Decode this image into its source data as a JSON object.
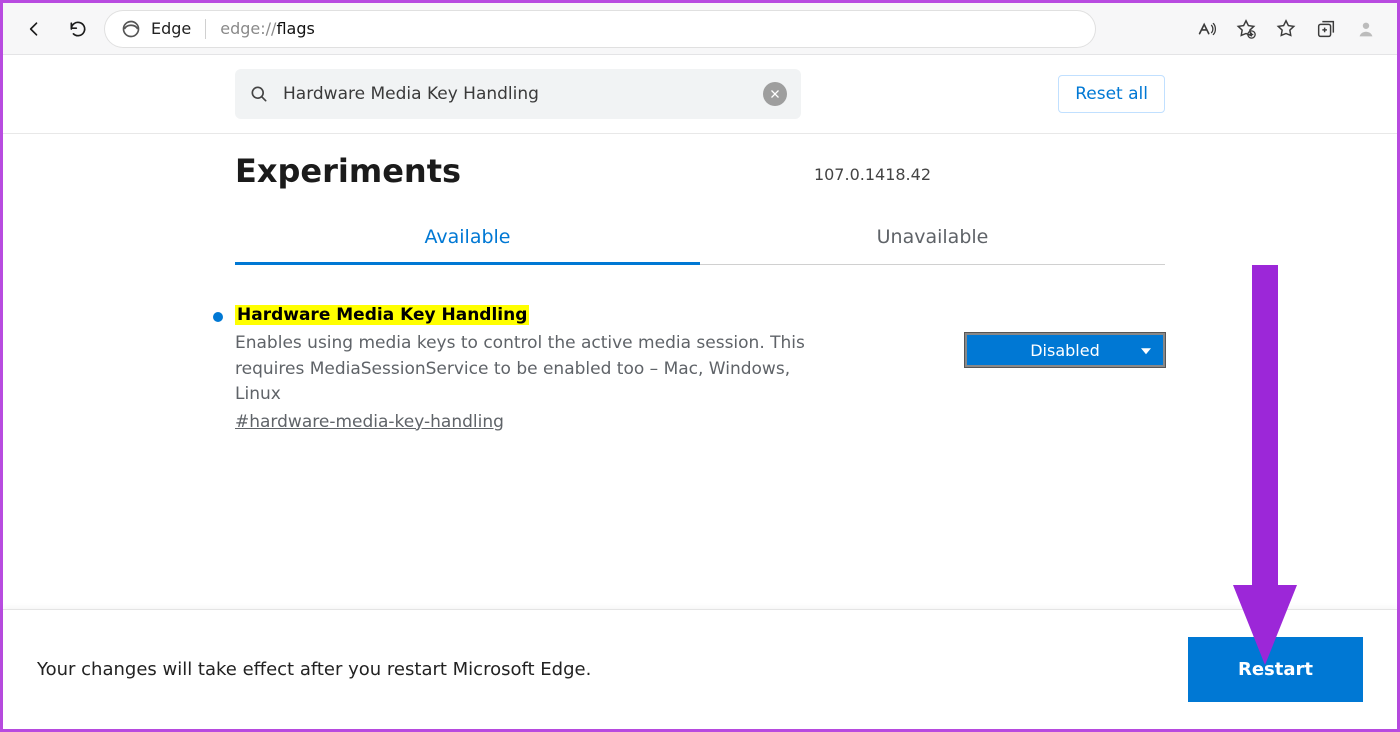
{
  "browser": {
    "name": "Edge",
    "url_prefix": "edge://",
    "url_path": "flags"
  },
  "search": {
    "value": "Hardware Media Key Handling"
  },
  "reset_label": "Reset all",
  "page_title": "Experiments",
  "version": "107.0.1418.42",
  "tabs": {
    "available": "Available",
    "unavailable": "Unavailable"
  },
  "experiment": {
    "name": "Hardware Media Key Handling",
    "description": "Enables using media keys to control the active media session. This requires MediaSessionService to be enabled too – Mac, Windows, Linux",
    "hash": "#hardware-media-key-handling",
    "select_value": "Disabled"
  },
  "restart": {
    "message": "Your changes will take effect after you restart Microsoft Edge.",
    "button": "Restart"
  }
}
